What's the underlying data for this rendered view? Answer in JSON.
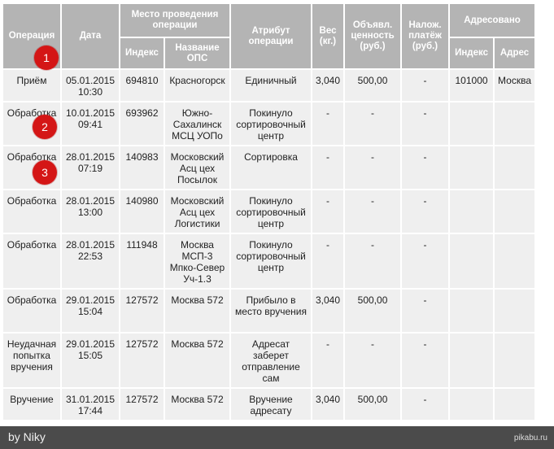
{
  "headers": {
    "operation": "Операция",
    "date": "Дата",
    "place": "Место проведения операции",
    "index": "Индекс",
    "ops_name": "Название ОПС",
    "attribute": "Атрибут операции",
    "weight": "Вес (кг.)",
    "declared": "Объявл. ценность (руб.)",
    "cod": "Налож. платёж (руб.)",
    "addressed": "Адресовано",
    "addr_index": "Индекс",
    "addr_address": "Адрес"
  },
  "rows": [
    {
      "operation": "Приём",
      "date": "05.01.2015 10:30",
      "index": "694810",
      "ops_name": "Красногорск",
      "attribute": "Единичный",
      "weight": "3,040",
      "declared": "500,00",
      "cod": "-",
      "addr_index": "101000",
      "addr_address": "Москва"
    },
    {
      "operation": "Обработка",
      "date": "10.01.2015 09:41",
      "index": "693962",
      "ops_name": "Южно-Сахалинск МСЦ УОПо",
      "attribute": "Покинуло сортировочный центр",
      "weight": "-",
      "declared": "-",
      "cod": "-",
      "addr_index": "",
      "addr_address": ""
    },
    {
      "operation": "Обработка",
      "date": "28.01.2015 07:19",
      "index": "140983",
      "ops_name": "Московский Асц цех Посылок",
      "attribute": "Сортировка",
      "weight": "-",
      "declared": "-",
      "cod": "-",
      "addr_index": "",
      "addr_address": ""
    },
    {
      "operation": "Обработка",
      "date": "28.01.2015 13:00",
      "index": "140980",
      "ops_name": "Московский Асц цех Логистики",
      "attribute": "Покинуло сортировочный центр",
      "weight": "-",
      "declared": "-",
      "cod": "-",
      "addr_index": "",
      "addr_address": ""
    },
    {
      "operation": "Обработка",
      "date": "28.01.2015 22:53",
      "index": "111948",
      "ops_name": "Москва МСП-3 Мпко-Север Уч-1.3",
      "attribute": "Покинуло сортировочный центр",
      "weight": "-",
      "declared": "-",
      "cod": "-",
      "addr_index": "",
      "addr_address": ""
    },
    {
      "operation": "Обработка",
      "date": "29.01.2015 15:04",
      "index": "127572",
      "ops_name": "Москва 572",
      "attribute": "Прибыло в место вручения",
      "weight": "3,040",
      "declared": "500,00",
      "cod": "-",
      "addr_index": "",
      "addr_address": ""
    },
    {
      "operation": "Неудачная попытка вручения",
      "date": "29.01.2015 15:05",
      "index": "127572",
      "ops_name": "Москва 572",
      "attribute": "Адресат заберет отправление сам",
      "weight": "-",
      "declared": "-",
      "cod": "-",
      "addr_index": "",
      "addr_address": ""
    },
    {
      "operation": "Вручение",
      "date": "31.01.2015 17:44",
      "index": "127572",
      "ops_name": "Москва 572",
      "attribute": "Вручение адресату",
      "weight": "3,040",
      "declared": "500,00",
      "cod": "-",
      "addr_index": "",
      "addr_address": ""
    }
  ],
  "markers": [
    "1",
    "2",
    "3"
  ],
  "footer": {
    "by": "by Niky",
    "site": "pikabu.ru"
  },
  "colors": {
    "header_bg": "#b4b4b4",
    "cell_bg": "#efefef",
    "marker": "#d41616",
    "footer_bg": "#4b4b4b",
    "link": "#3a5a9a"
  }
}
